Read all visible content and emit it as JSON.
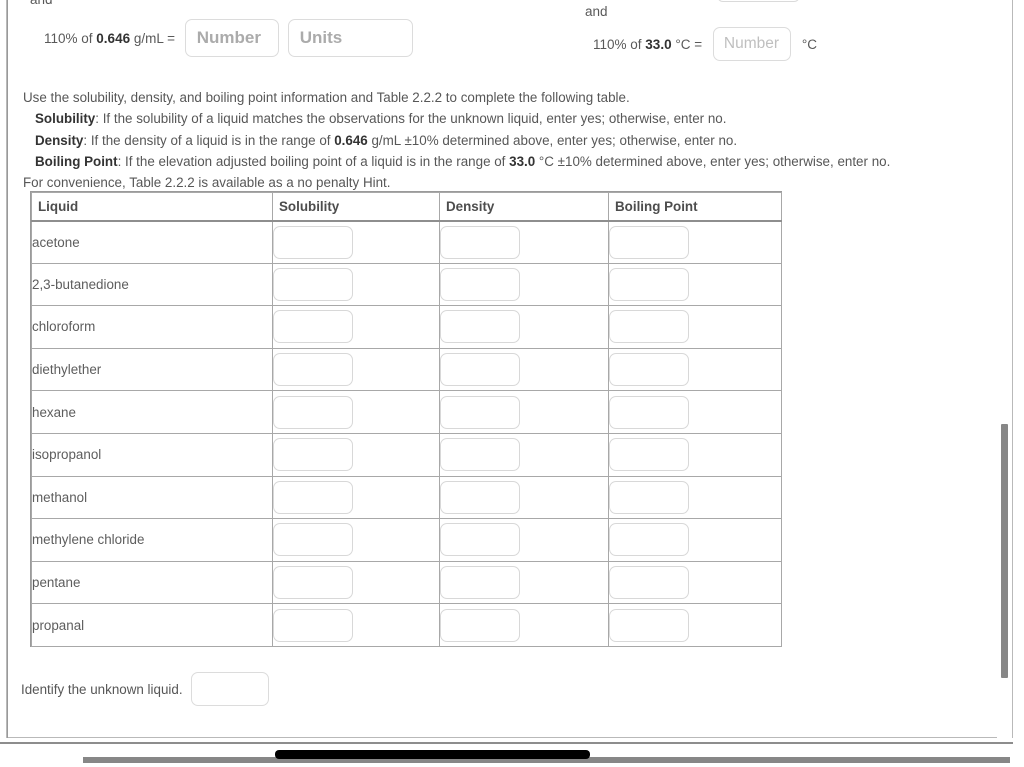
{
  "density_line": {
    "and_label": "and",
    "prefix": "110% of ",
    "value": "0.646",
    "unit_suffix": " g/mL = ",
    "number_placeholder": "Number",
    "units_placeholder": "Units",
    "number_value": "",
    "units_value": ""
  },
  "boiling_line": {
    "and_label": "and",
    "prefix": "110% of ",
    "value": "33.0",
    "unit_suffix": " °C = ",
    "number_placeholder": "Number",
    "number_value": "",
    "trailing_unit": "°C"
  },
  "instructions": {
    "intro": "Use the solubility, density, and boiling point information and Table 2.2.2 to complete the following table.",
    "solubility_label": "Solubility",
    "solubility_text": ": If the solubility of a liquid matches the observations for the unknown liquid, enter yes; otherwise, enter no.",
    "density_label": "Density",
    "density_text_a": ": If the density of a liquid is in the range of ",
    "density_value": "0.646",
    "density_text_b": " g/mL ±10% determined above, enter yes; otherwise, enter no.",
    "boiling_label": "Boiling Point",
    "boiling_text_a": ": If the elevation adjusted boiling point of a liquid is in the range of ",
    "boiling_value": "33.0",
    "boiling_text_b": " °C ±10% determined above, enter yes; otherwise, enter no.",
    "hint": "For convenience, Table 2.2.2 is available as a no penalty Hint."
  },
  "table": {
    "headers": [
      "Liquid",
      "Solubility",
      "Density",
      "Boiling Point"
    ],
    "rows": [
      {
        "liquid": "acetone",
        "solubility": "",
        "density": "",
        "boiling_point": ""
      },
      {
        "liquid": "2,3-butanedione",
        "solubility": "",
        "density": "",
        "boiling_point": ""
      },
      {
        "liquid": "chloroform",
        "solubility": "",
        "density": "",
        "boiling_point": ""
      },
      {
        "liquid": "diethylether",
        "solubility": "",
        "density": "",
        "boiling_point": ""
      },
      {
        "liquid": "hexane",
        "solubility": "",
        "density": "",
        "boiling_point": ""
      },
      {
        "liquid": "isopropanol",
        "solubility": "",
        "density": "",
        "boiling_point": ""
      },
      {
        "liquid": "methanol",
        "solubility": "",
        "density": "",
        "boiling_point": ""
      },
      {
        "liquid": "methylene chloride",
        "solubility": "",
        "density": "",
        "boiling_point": ""
      },
      {
        "liquid": "pentane",
        "solubility": "",
        "density": "",
        "boiling_point": ""
      },
      {
        "liquid": "propanal",
        "solubility": "",
        "density": "",
        "boiling_point": ""
      }
    ]
  },
  "identify": {
    "label": "Identify the unknown liquid.",
    "value": ""
  },
  "colors": {
    "text": "#575757",
    "bold_text": "#333333",
    "table_border": "#a8a8a8",
    "input_border": "#dcdcdc",
    "scrollbar": "#878787",
    "hscroll_thumb": "#000000"
  }
}
